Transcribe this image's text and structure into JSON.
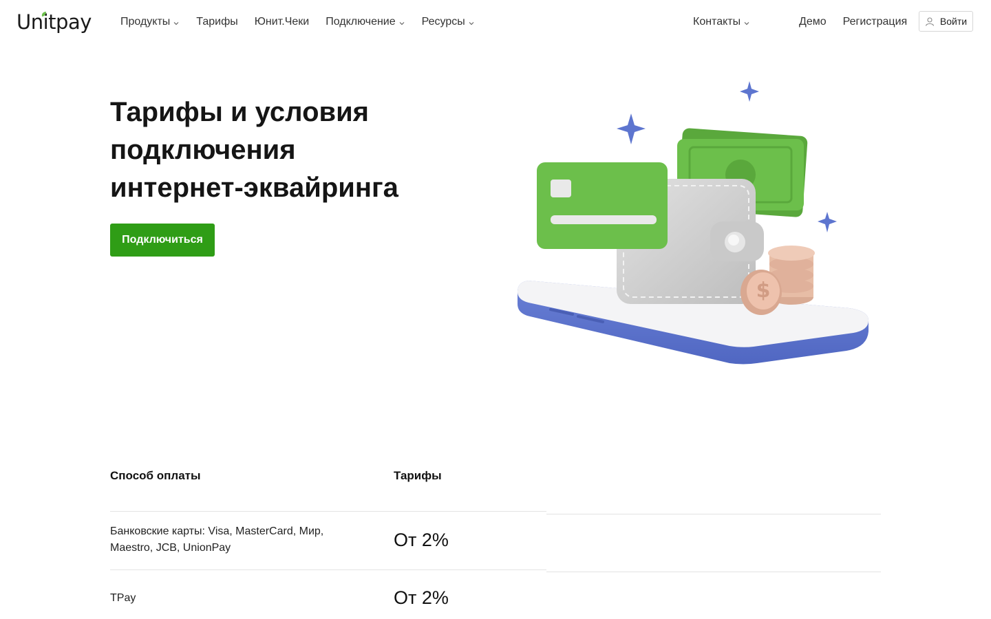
{
  "header": {
    "logo": "Unitpay",
    "nav": [
      {
        "label": "Продукты",
        "has_dropdown": true
      },
      {
        "label": "Тарифы",
        "has_dropdown": false
      },
      {
        "label": "Юнит.Чеки",
        "has_dropdown": false
      },
      {
        "label": "Подключение",
        "has_dropdown": true
      },
      {
        "label": "Ресурсы",
        "has_dropdown": true
      }
    ],
    "contacts": "Контакты",
    "demo": "Демо",
    "register": "Регистрация",
    "login": "Войти"
  },
  "hero": {
    "title_line1": "Тарифы и условия",
    "title_line2": "подключения",
    "title_line3": "интернет-эквайринга",
    "cta": "Подключиться"
  },
  "table": {
    "headers": [
      "Способ оплаты",
      "Тарифы"
    ],
    "rows": [
      {
        "method_line1": "Банковские карты: Visa, MasterCard, Мир,",
        "method_line2": "Maestro, JCB, UnionPay",
        "rate": "От 2%"
      },
      {
        "method_line1": "TPay",
        "method_line2": "",
        "rate": "От 2%"
      }
    ]
  },
  "colors": {
    "brand_green": "#2f9d16",
    "illustration_blue": "#5d75cf",
    "illustration_green": "#6cbf4b"
  }
}
